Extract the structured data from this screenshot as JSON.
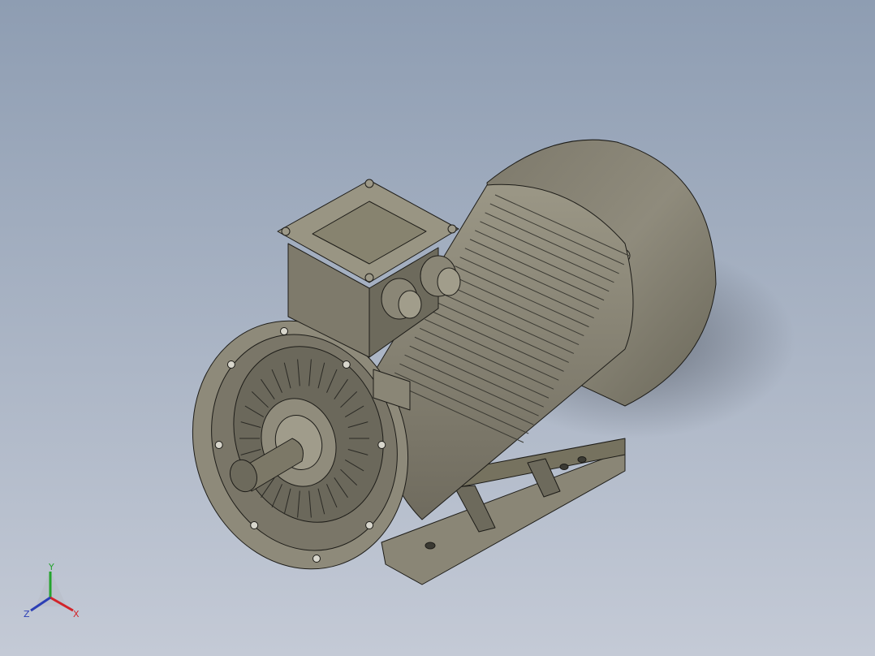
{
  "viewport": {
    "background_top": "#8e9db2",
    "background_bottom": "#c4cad6"
  },
  "model": {
    "body_color": "#8e8a7a",
    "shadow_color": "#5f5c51",
    "highlight_color": "#b3ae9d",
    "edge_color": "#1d1c18"
  },
  "triad": {
    "x_label": "X",
    "y_label": "Y",
    "z_label": "Z",
    "x_color": "#d2242a",
    "y_color": "#24a32d",
    "z_color": "#2c3fb5"
  }
}
